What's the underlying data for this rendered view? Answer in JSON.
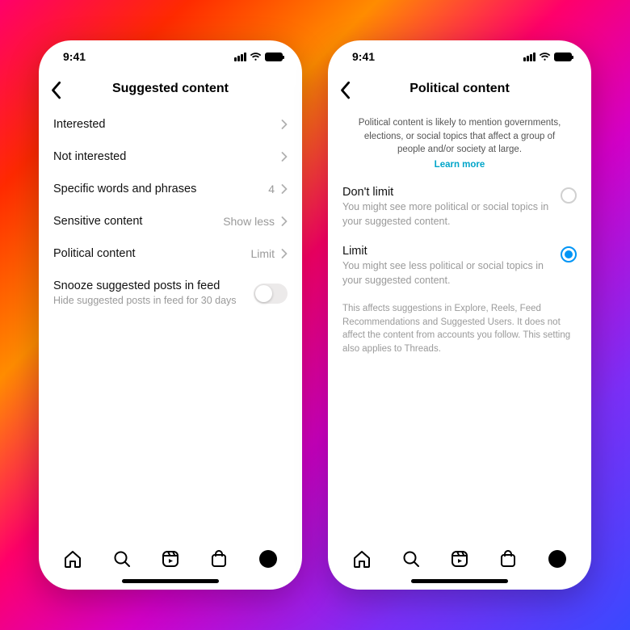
{
  "status": {
    "time": "9:41"
  },
  "left": {
    "title": "Suggested content",
    "rows": [
      {
        "label": "Interested",
        "value": ""
      },
      {
        "label": "Not interested",
        "value": ""
      },
      {
        "label": "Specific words and phrases",
        "value": "4"
      },
      {
        "label": "Sensitive content",
        "value": "Show less"
      },
      {
        "label": "Political content",
        "value": "Limit"
      }
    ],
    "snooze": {
      "label": "Snooze suggested posts in feed",
      "sub": "Hide suggested posts in feed for 30 days"
    }
  },
  "right": {
    "title": "Political content",
    "intro": "Political content is likely to mention governments, elections, or social topics that affect a group of people and/or society at large.",
    "learn": "Learn more",
    "options": [
      {
        "title": "Don't limit",
        "desc": "You might see more political or social topics in your suggested content.",
        "selected": false
      },
      {
        "title": "Limit",
        "desc": "You might see less political or social topics in your suggested content.",
        "selected": true
      }
    ],
    "footnote": "This affects suggestions in Explore, Reels, Feed Recommendations and Suggested Users. It does not affect the content from accounts you follow. This setting also applies to Threads."
  }
}
